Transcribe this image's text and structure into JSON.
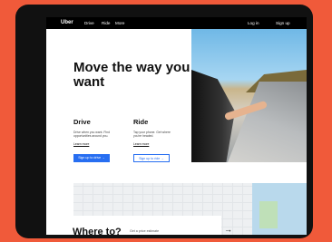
{
  "nav": {
    "logo": "Uber",
    "links": [
      "Drive",
      "Ride",
      "More"
    ],
    "login": "Log in",
    "signup": "Sign up"
  },
  "hero": {
    "title": "Move the way you want"
  },
  "drive": {
    "title": "Drive",
    "text": "Drive when you want. Find opportunities around you.",
    "learn": "Learn more",
    "button": "Sign up to drive  →"
  },
  "ride": {
    "title": "Ride",
    "text": "Tap your phone. Get where you're headed.",
    "learn": "Learn more",
    "button": "Sign up to ride  →"
  },
  "where": {
    "title": "Where to?",
    "estimate": "Get a price estimate",
    "arrow": "→"
  },
  "colors": {
    "background": "#f05a3a",
    "accent": "#276ef1",
    "nav": "#000000"
  }
}
